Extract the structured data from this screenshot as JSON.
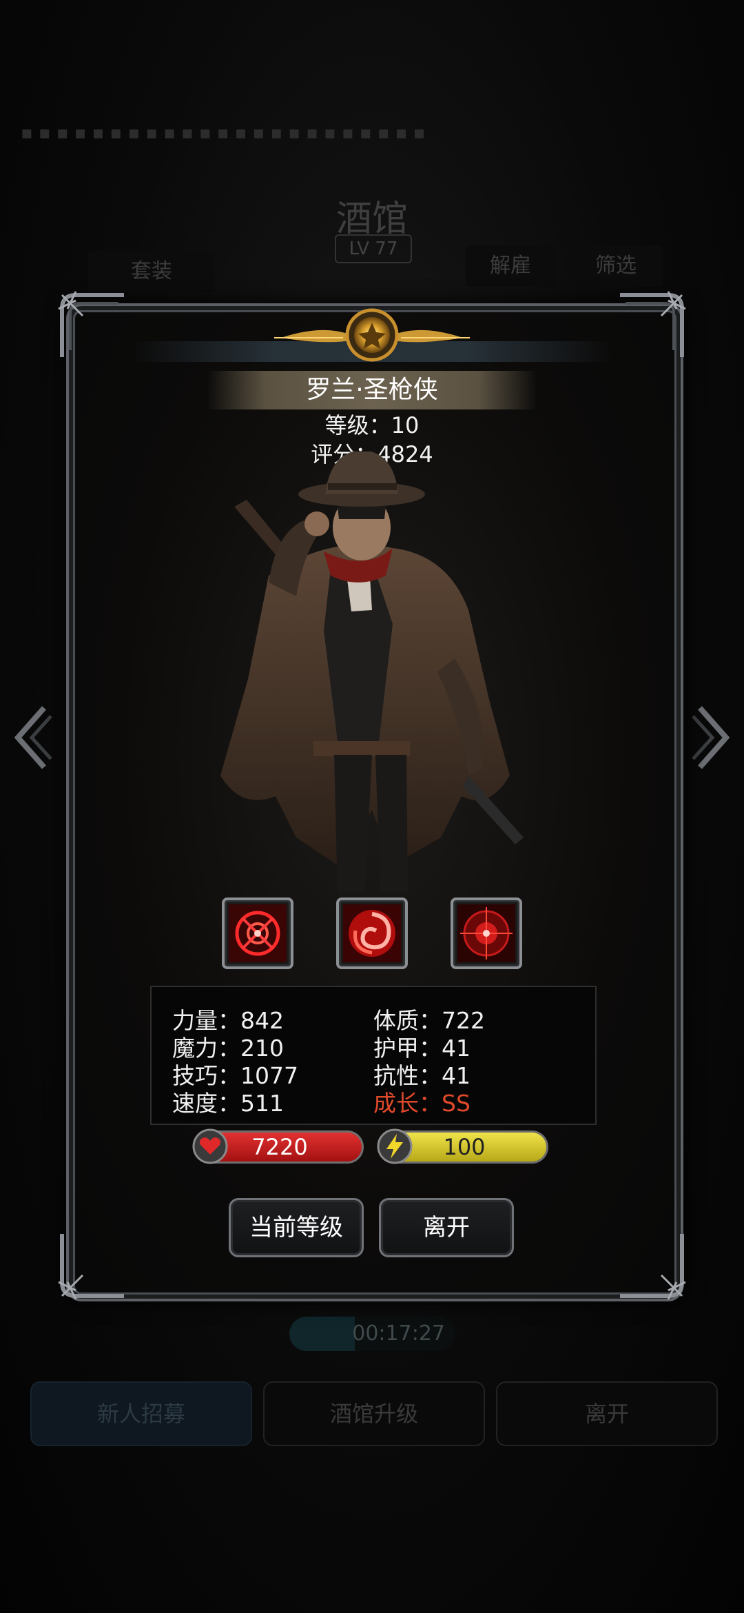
{
  "background": {
    "title": "酒馆",
    "level_badge": "LV 77",
    "suit_button": "套装",
    "dismiss_button": "解雇",
    "filter_button": "筛选",
    "timer": "00:17:27",
    "bottom_buttons": [
      "新人招募",
      "酒馆升级",
      "离开"
    ]
  },
  "hero": {
    "name": "罗兰·圣枪侠",
    "level_text": "等级：10",
    "score_text": "评分：4824",
    "skills": [
      "crosshair-skill-icon",
      "vortex-skill-icon",
      "target-skill-icon"
    ]
  },
  "stats": {
    "strength": "力量：842",
    "constitution": "体质：722",
    "magic": "魔力：210",
    "armor": "护甲：41",
    "skill": "技巧：1077",
    "resistance": "抗性：41",
    "speed": "速度：511",
    "growth": "成长：SS"
  },
  "bars": {
    "hp": "7220",
    "energy": "100"
  },
  "buttons": {
    "current_level": "当前等级",
    "leave": "离开"
  },
  "colors": {
    "growth": "#e04a2a",
    "hp": "#c61e1e",
    "energy": "#d8c92e"
  }
}
